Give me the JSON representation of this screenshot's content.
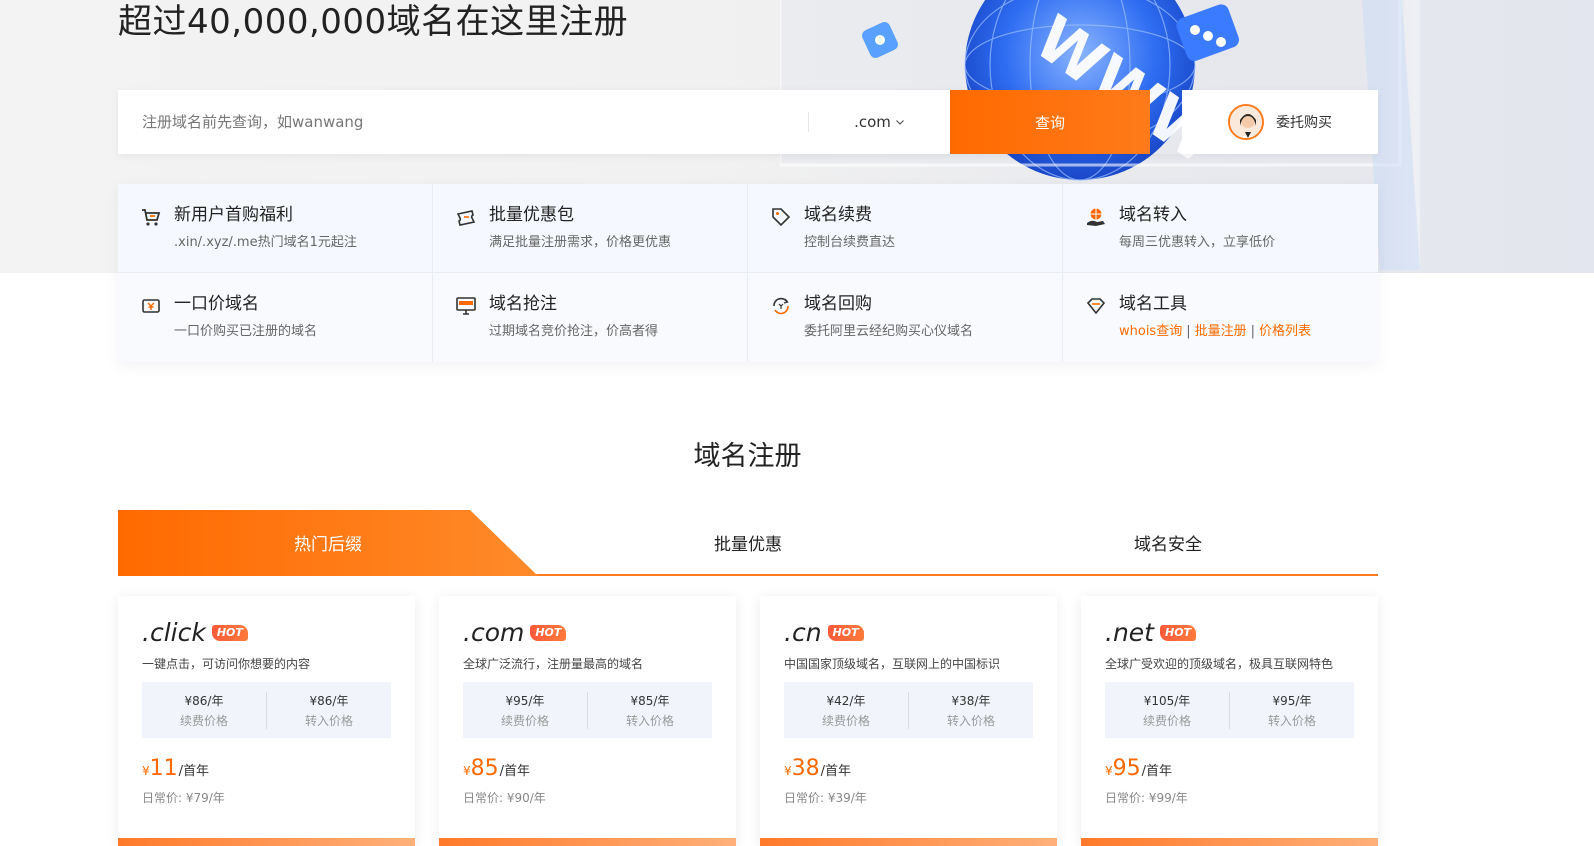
{
  "hero": {
    "title": "超过40,000,000域名在这里注册"
  },
  "search": {
    "placeholder": "注册域名前先查询，如wanwang",
    "suffix": ".com",
    "button_label": "查询",
    "delegate_label": "委托购买"
  },
  "features": [
    {
      "title": "新用户首购福利",
      "desc": ".xin/.xyz/.me热门域名1元起注",
      "icon": "cart-icon"
    },
    {
      "title": "批量优惠包",
      "desc": "满足批量注册需求，价格更优惠",
      "icon": "ticket-icon"
    },
    {
      "title": "域名续费",
      "desc": "控制台续费直达",
      "icon": "tag-icon"
    },
    {
      "title": "域名转入",
      "desc": "每周三优惠转入，立享低价",
      "icon": "globe-hand-icon"
    },
    {
      "title": "一口价域名",
      "desc": "一口价购买已注册的域名",
      "icon": "yen-ticket-icon"
    },
    {
      "title": "域名抢注",
      "desc": "过期域名竞价抢注，价高者得",
      "icon": "www-monitor-icon"
    },
    {
      "title": "域名回购",
      "desc": "委托阿里云经纪购买心仪域名",
      "icon": "refresh-yen-icon"
    },
    {
      "title": "域名工具",
      "icon": "diamond-icon",
      "links": [
        "whois查询",
        "批量注册",
        "价格列表"
      ],
      "sep": "|"
    }
  ],
  "section": {
    "title": "域名注册"
  },
  "tabs": [
    "热门后缀",
    "批量优惠",
    "域名安全"
  ],
  "cards": [
    {
      "suffix": ".click",
      "badge": "HOT",
      "desc": "一键点击，可访问你想要的内容",
      "renew": "¥86/年",
      "renew_label": "续费价格",
      "transfer": "¥86/年",
      "transfer_label": "转入价格",
      "currency": "¥",
      "price": "11",
      "unit": "/首年",
      "regular": "日常价:   ¥79/年"
    },
    {
      "suffix": ".com",
      "badge": "HOT",
      "desc": "全球广泛流行，注册量最高的域名",
      "renew": "¥95/年",
      "renew_label": "续费价格",
      "transfer": "¥85/年",
      "transfer_label": "转入价格",
      "currency": "¥",
      "price": "85",
      "unit": "/首年",
      "regular": "日常价:   ¥90/年"
    },
    {
      "suffix": ".cn",
      "badge": "HOT",
      "desc": "中国国家顶级域名，互联网上的中国标识",
      "renew": "¥42/年",
      "renew_label": "续费价格",
      "transfer": "¥38/年",
      "transfer_label": "转入价格",
      "currency": "¥",
      "price": "38",
      "unit": "/首年",
      "regular": "日常价:   ¥39/年"
    },
    {
      "suffix": ".net",
      "badge": "HOT",
      "desc": "全球广受欢迎的顶级域名，极具互联网特色",
      "renew": "¥105/年",
      "renew_label": "续费价格",
      "transfer": "¥95/年",
      "transfer_label": "转入价格",
      "currency": "¥",
      "price": "95",
      "unit": "/首年",
      "regular": "日常价:   ¥99/年"
    }
  ],
  "colors": {
    "accent": "#ff6a00",
    "feature_bg": "#f5f8fd",
    "price_box_bg": "#f1f5fb"
  }
}
